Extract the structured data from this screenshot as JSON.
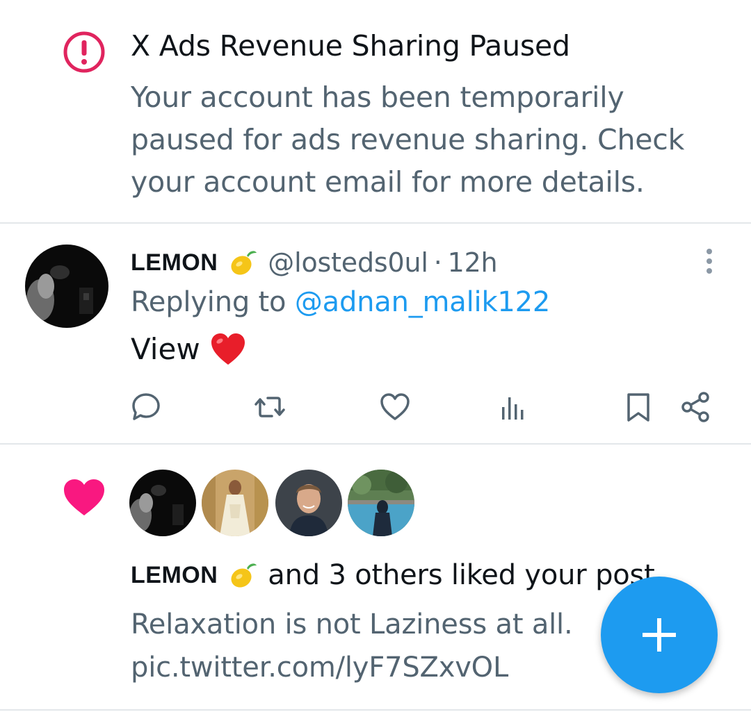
{
  "notification_alert": {
    "title": "X Ads Revenue Sharing Paused",
    "body": "Your account has been temporarily paused for ads revenue sharing. Check your account email for more details.",
    "icon": "alert-circle-icon",
    "icon_color": "#e0245e"
  },
  "tweet": {
    "author_name": "LEMON",
    "author_emoji": "lemon-emoji",
    "handle": "@losteds0ul",
    "separator": "·",
    "time": "12h",
    "replying_prefix": "Replying to",
    "replying_to": "@adnan_malik122",
    "text": "View",
    "text_emoji": "red-heart-emoji",
    "actions": [
      "reply-icon",
      "retweet-icon",
      "like-icon",
      "views-icon",
      "bookmark-icon",
      "share-icon"
    ]
  },
  "notification_like": {
    "icon": "heart-icon",
    "icon_color": "#f91880",
    "liker_name": "LEMON",
    "liker_emoji": "lemon-emoji",
    "rest_text": "and 3 others liked your post",
    "post_text": "Relaxation is not Laziness at all.",
    "post_link": "pic.twitter.com/lyF7SZxvOL",
    "avatars": [
      "avatar-dark-portrait",
      "avatar-woman-gold",
      "avatar-man-portrait",
      "avatar-pool-scene"
    ]
  },
  "fab": {
    "icon": "plus-icon",
    "color": "#1d9bf0"
  },
  "colors": {
    "secondary_text": "#536471",
    "link": "#1d9bf0",
    "primary_text": "#0f1419",
    "divider": "#e3e7ea"
  }
}
